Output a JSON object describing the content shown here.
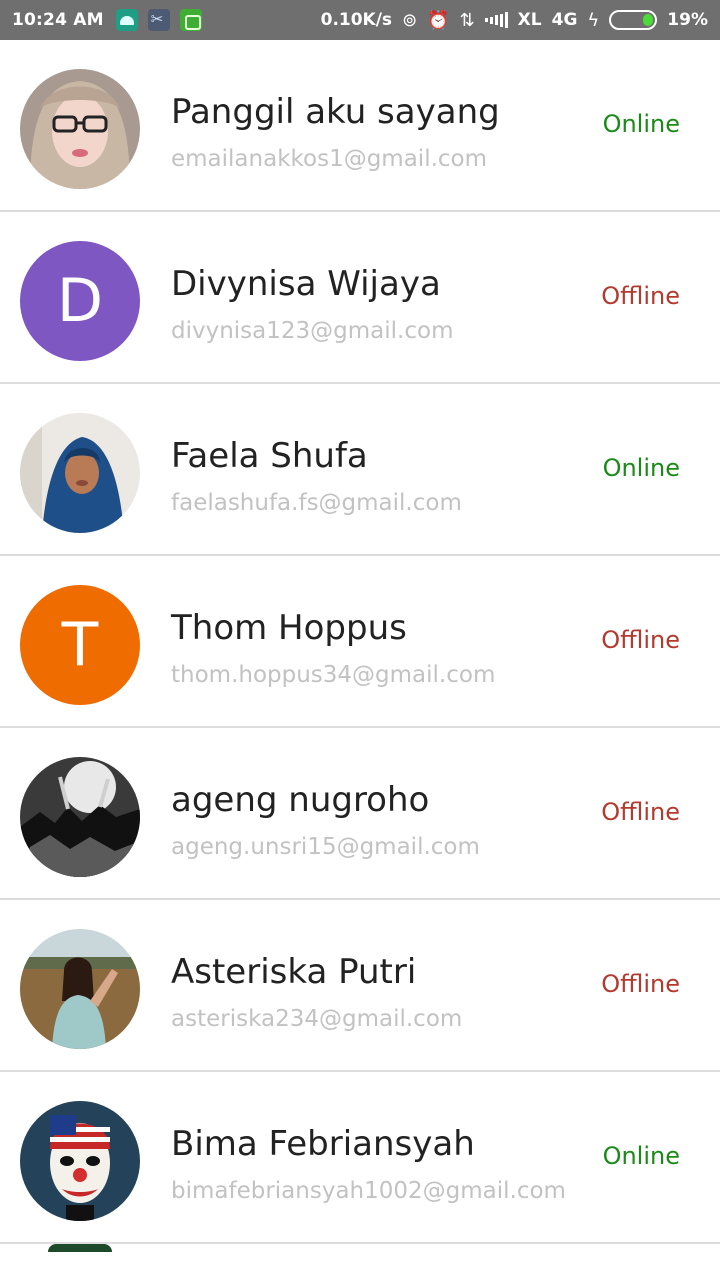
{
  "status_bar": {
    "time": "10:24 AM",
    "net_speed": "0.10K/s",
    "carrier": "XL",
    "network_type": "4G",
    "battery_percent": "19%",
    "battery_level": 0.19,
    "notification_icons": [
      "android-icon",
      "scissors-icon",
      "bot-icon"
    ],
    "system_icons": [
      "hotspot-icon",
      "alarm-icon",
      "data-transfer-icon",
      "signal-icon",
      "charging-icon"
    ]
  },
  "contacts": [
    {
      "name": "Panggil aku sayang",
      "email": "emailanakkos1@gmail.com",
      "status": "Online",
      "avatar_type": "photo",
      "avatar_icon": "woman-glasses-photo"
    },
    {
      "name": "Divynisa Wijaya",
      "email": "divynisa123@gmail.com",
      "status": "Offline",
      "avatar_type": "letter",
      "avatar_letter": "D",
      "avatar_color": "#7e57c2"
    },
    {
      "name": "Faela Shufa",
      "email": "faelashufa.fs@gmail.com",
      "status": "Online",
      "avatar_type": "photo",
      "avatar_icon": "woman-hijab-photo"
    },
    {
      "name": "Thom Hoppus",
      "email": "thom.hoppus34@gmail.com",
      "status": "Offline",
      "avatar_type": "letter",
      "avatar_letter": "T",
      "avatar_color": "#ef6c00"
    },
    {
      "name": "ageng nugroho",
      "email": "ageng.unsri15@gmail.com",
      "status": "Offline",
      "avatar_type": "photo",
      "avatar_icon": "concert-crowd-photo"
    },
    {
      "name": "Asteriska Putri",
      "email": "asteriska234@gmail.com",
      "status": "Offline",
      "avatar_type": "photo",
      "avatar_icon": "woman-outdoor-photo"
    },
    {
      "name": "Bima Febriansyah",
      "email": "bimafebriansyah1002@gmail.com",
      "status": "Online",
      "avatar_type": "photo",
      "avatar_icon": "clown-mask-photo"
    }
  ],
  "colors": {
    "online": "#1b8a17",
    "offline": "#b23a2e",
    "status_bar_bg": "#6f6f6f",
    "divider": "#dddddd"
  }
}
